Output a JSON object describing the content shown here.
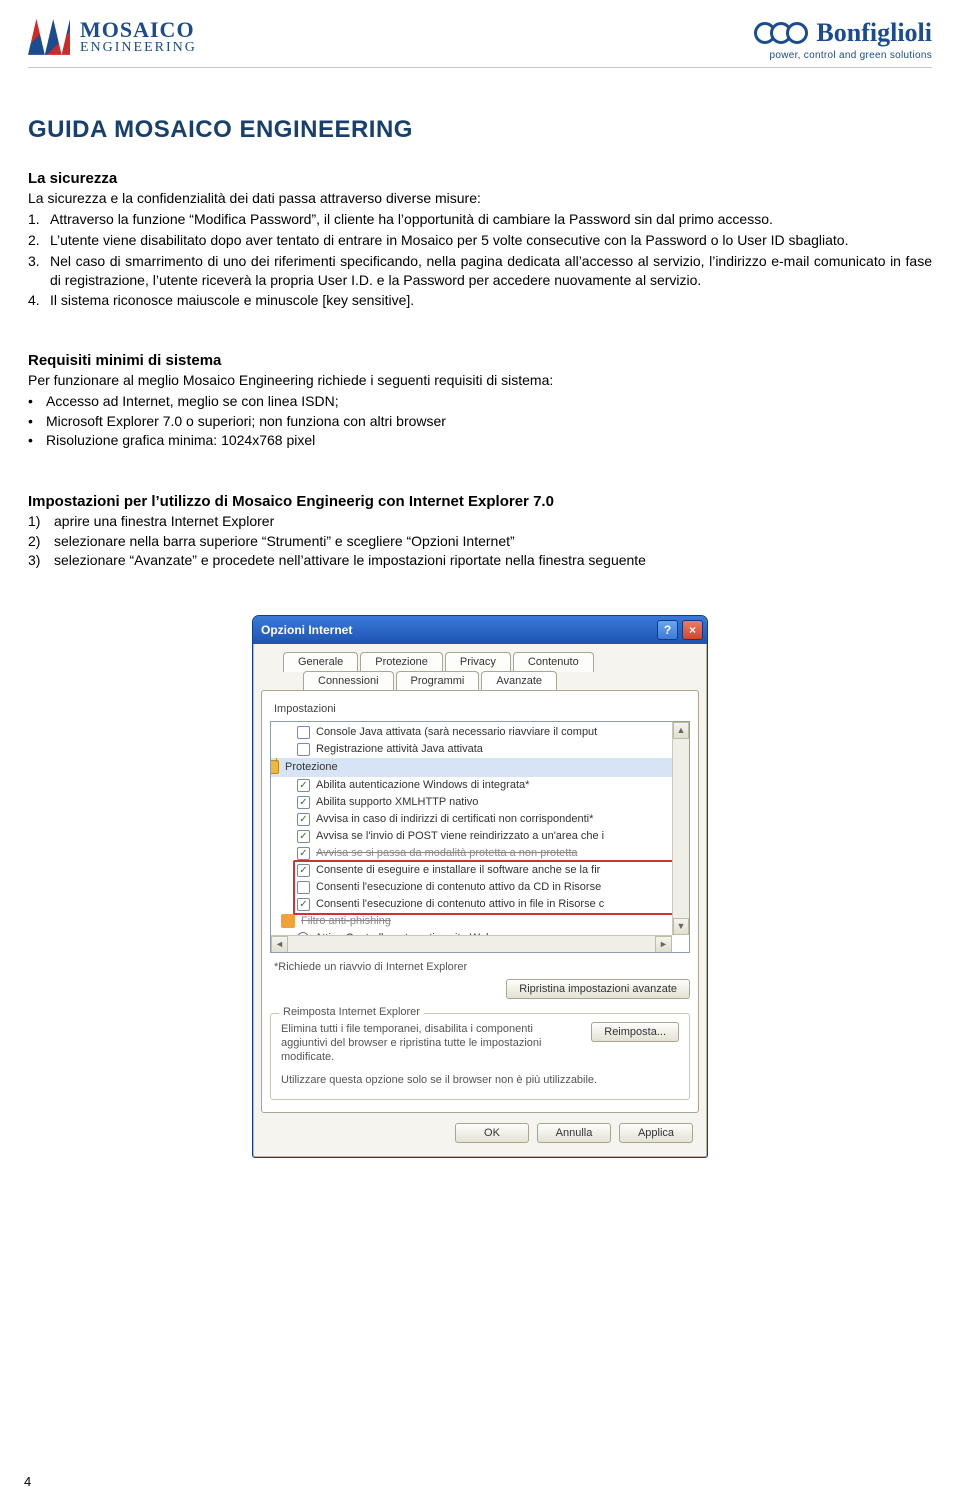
{
  "header": {
    "left": {
      "line1": "MOSAICO",
      "line2": "ENGINEERING"
    },
    "right": {
      "brand": "Bonfiglioli",
      "tagline": "power, control and green solutions"
    }
  },
  "doc_title": "GUIDA MOSAICO ENGINEERING",
  "security": {
    "heading": "La sicurezza",
    "lead": "La sicurezza e la confidenzialità dei dati passa attraverso diverse misure:",
    "items": [
      "Attraverso la funzione “Modifica Password”, il cliente ha l’opportunità di cambiare la Password sin dal primo accesso.",
      "L’utente viene disabilitato dopo aver tentato di entrare in Mosaico per 5 volte consecutive con la Password o lo User ID sbagliato.",
      "Nel caso di smarrimento di uno dei riferimenti specificando, nella pagina dedicata all’accesso al servizio, l’indirizzo e-mail comunicato in fase di registrazione, l’utente riceverà la propria User I.D. e la Password per accedere nuovamente al servizio.",
      "Il sistema riconosce maiuscole e minuscole [key sensitive]."
    ]
  },
  "requirements": {
    "heading": "Requisiti minimi di sistema",
    "lead": "Per funzionare al meglio Mosaico Engineering richiede i seguenti requisiti di sistema:",
    "items": [
      "Accesso ad Internet, meglio se con linea ISDN;",
      "Microsoft Explorer 7.0 o superiori; non funziona con altri browser",
      "Risoluzione grafica minima: 1024x768 pixel"
    ]
  },
  "settings": {
    "heading": "Impostazioni per l’utilizzo di Mosaico Engineerig con Internet Explorer 7.0",
    "items": [
      "aprire una finestra Internet Explorer",
      "selezionare nella barra superiore “Strumenti” e scegliere “Opzioni Internet”",
      "selezionare “Avanzate” e procedete nell’attivare le impostazioni riportate nella finestra seguente"
    ]
  },
  "dialog": {
    "title": "Opzioni Internet",
    "help": "?",
    "close": "×",
    "tabs_row1": [
      "Generale",
      "Protezione",
      "Privacy",
      "Contenuto"
    ],
    "tabs_row2": [
      "Connessioni",
      "Programmi",
      "Avanzate"
    ],
    "active_tab": "Avanzate",
    "group_label": "Impostazioni",
    "tree": {
      "pre_section": [
        {
          "checked": false,
          "label": "Console Java attivata (sarà necessario riavviare il comput"
        },
        {
          "checked": false,
          "label": "Registrazione attività Java attivata"
        }
      ],
      "section1_label": "Protezione",
      "section1": [
        {
          "checked": true,
          "label": "Abilita autenticazione Windows di integrata*"
        },
        {
          "checked": true,
          "label": "Abilita supporto XMLHTTP nativo"
        },
        {
          "checked": true,
          "label": "Avvisa in caso di indirizzi di certificati non corrispondenti*"
        },
        {
          "checked": true,
          "label": "Avvisa se l'invio di POST viene reindirizzato a un'area che i"
        },
        {
          "checked": true,
          "strike": true,
          "label": "Avvisa se si passa da modalità protetta a non protetta"
        },
        {
          "checked": true,
          "hl": true,
          "label": "Consente di eseguire e installare il software anche se la fir"
        },
        {
          "checked": false,
          "hl": true,
          "label": "Consenti l'esecuzione di contenuto attivo da CD in Risorse"
        },
        {
          "checked": true,
          "hl": true,
          "label": "Consenti l'esecuzione di contenuto attivo in file in Risorse c"
        }
      ],
      "section2_label": "Filtro anti-phishing",
      "section2_strike": true,
      "section2": [
        {
          "radio": true,
          "label": "Attiva Controllo automatico sito Web"
        }
      ]
    },
    "note": "*Richiede un riavvio di Internet Explorer",
    "restore_btn": "Ripristina impostazioni avanzate",
    "reset_legend": "Reimposta Internet Explorer",
    "reset_text1": "Elimina tutti i file temporanei, disabilita i componenti aggiuntivi del browser e ripristina tutte le impostazioni modificate.",
    "reset_text2": "Utilizzare questa opzione solo se il browser non è più utilizzabile.",
    "reset_btn": "Reimposta...",
    "footer": {
      "ok": "OK",
      "cancel": "Annulla",
      "apply": "Applica"
    }
  },
  "page_number": "4"
}
